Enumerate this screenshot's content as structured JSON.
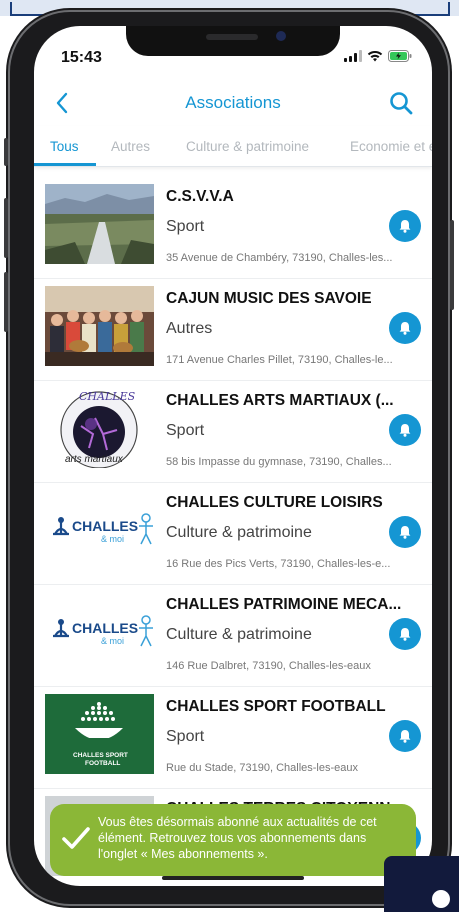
{
  "status": {
    "time": "15:43"
  },
  "nav": {
    "title": "Associations"
  },
  "tabs": [
    "Tous",
    "Autres",
    "Culture & patrimoine",
    "Economie et e"
  ],
  "items": [
    {
      "title": "C.S.V.V.A",
      "category": "Sport",
      "address": "35 Avenue de Chambéry, 73190, Challes-les..."
    },
    {
      "title": "CAJUN MUSIC DES SAVOIE",
      "category": "Autres",
      "address": "171 Avenue Charles Pillet, 73190, Challes-le..."
    },
    {
      "title": "CHALLES ARTS MARTIAUX (...",
      "category": "Sport",
      "address": "58 bis Impasse du gymnase, 73190, Challes..."
    },
    {
      "title": "CHALLES CULTURE LOISIRS",
      "category": "Culture & patrimoine",
      "address": "16 Rue des Pics Verts, 73190, Challes-les-e..."
    },
    {
      "title": "CHALLES PATRIMOINE MECA...",
      "category": "Culture & patrimoine",
      "address": "146 Rue Dalbret, 73190, Challes-les-eaux"
    },
    {
      "title": "CHALLES SPORT FOOTBALL",
      "category": "Sport",
      "address": "Rue du Stade, 73190, Challes-les-eaux"
    },
    {
      "title": "CHALLES TERRES CITOYENN...",
      "category": "",
      "address": ""
    }
  ],
  "logos": {
    "challes_moi": {
      "word": "CHALLES",
      "sub": "& moi"
    },
    "arts_martiaux": {
      "top": "CHALLES",
      "bottom": "arts martiaux"
    },
    "football": {
      "line1": "CHALLES SPORT",
      "line2": "FOOTBALL"
    }
  },
  "toast": {
    "message": "Vous êtes désormais abonné aux actualités de cet élément. Retrouvez tous vos abonnements dans l'onglet « Mes abonnements »."
  },
  "colors": {
    "accent": "#1596d3",
    "toast": "#8bb737",
    "phone": "#1b1b1d"
  },
  "icons": [
    "back-chevron-icon",
    "search-icon",
    "bell-icon",
    "check-icon",
    "signal-icon",
    "wifi-icon",
    "battery-icon"
  ]
}
